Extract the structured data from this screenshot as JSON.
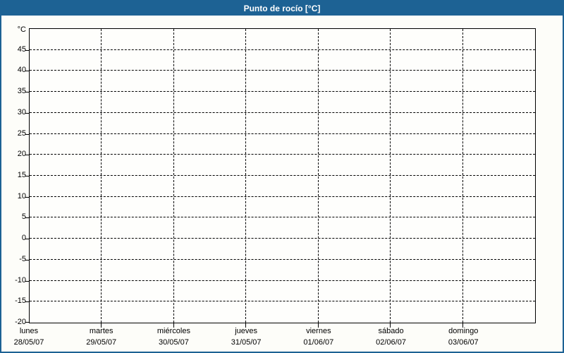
{
  "window": {
    "title": "Punto de rocío [°C]",
    "colors": {
      "titlebar_bg": "#1d6294",
      "titlebar_text": "#ffffff",
      "window_border": "#1d6294",
      "window_bg": "#fdfdf9",
      "plot_bg": "#fefefc",
      "axis": "#000000",
      "grid": "#000000",
      "label_text": "#000000"
    }
  },
  "chart_data": {
    "type": "line",
    "title": "Punto de rocío [°C]",
    "ylabel": "°C",
    "ylim": [
      -20,
      50
    ],
    "ytick_step": 5,
    "ytick_labels": [
      "45",
      "40",
      "35",
      "30",
      "25",
      "20",
      "15",
      "10",
      "5",
      "0",
      "-5",
      "-10",
      "-15",
      "-20"
    ],
    "xlim_days": [
      0,
      7
    ],
    "x_days": [
      {
        "name": "lunes",
        "date": "28/05/07"
      },
      {
        "name": "martes",
        "date": "29/05/07"
      },
      {
        "name": "miércoles",
        "date": "30/05/07"
      },
      {
        "name": "jueves",
        "date": "31/05/07"
      },
      {
        "name": "viernes",
        "date": "01/06/07"
      },
      {
        "name": "sábado",
        "date": "02/06/07"
      },
      {
        "name": "domingo",
        "date": "03/06/07"
      }
    ],
    "grid": {
      "style": "dashed",
      "horizontal": true,
      "vertical": true
    },
    "legend": null,
    "series": []
  }
}
